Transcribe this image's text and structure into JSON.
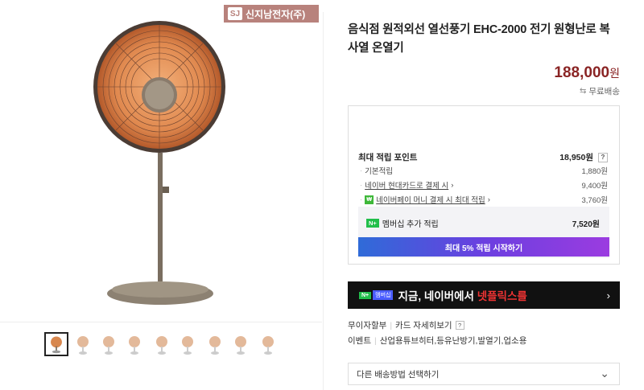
{
  "brand": {
    "logo_text": "SJ",
    "name": "신지남전자(주)"
  },
  "product": {
    "title": "음식점 원적외선 열선풍기 EHC-2000 전기 원형난로 복사열 온열기",
    "price": "188,000",
    "price_unit": "원",
    "shipping": "무료배송"
  },
  "points": {
    "max_label": "최대 적립 포인트",
    "max_value": "18,950원",
    "rows": [
      {
        "label": "기본적립",
        "value": "1,880원"
      },
      {
        "label": "네이버 현대카드로 결제 시",
        "value": "9,400원"
      },
      {
        "label": "네이버페이 머니 결제 시 최대 적립",
        "value": "3,760원"
      }
    ],
    "membership_badge": "N+",
    "membership_label": "멤버십 추가 적립",
    "membership_value": "7,520원",
    "membership_button": "최대 5% 적립 시작하기",
    "help": "?"
  },
  "banner": {
    "badge": "N+",
    "badge_sub": "멤버십",
    "text_pre": "지금,",
    "text_mid": "네이버에서",
    "text_hl": "넷플릭스를"
  },
  "info": {
    "installment": "무이자할부",
    "card_benefit": "카드 자세히보기",
    "event_label": "이벤트",
    "event_value": "산업용튜브히터,등유난방기,발열기,업소용"
  },
  "shipping_select": {
    "value": "다른 배송방법 선택하기"
  },
  "colors": {
    "price": "#8a2424",
    "brand_badge": "#b8827c",
    "npay_green": "#21bf4b"
  },
  "icons": [
    "shipping-icon",
    "chevron-right-icon",
    "chevron-down-icon",
    "npay-icon"
  ]
}
